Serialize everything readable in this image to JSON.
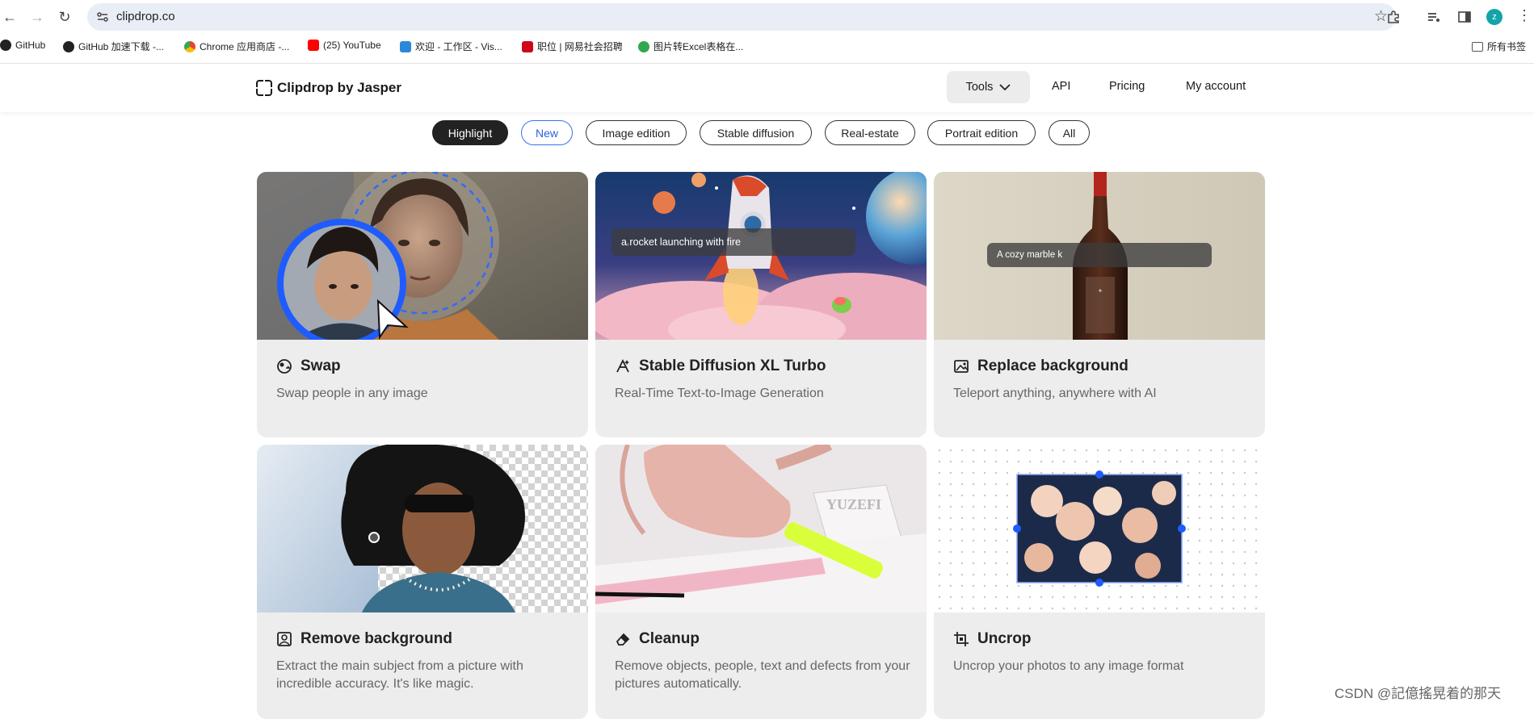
{
  "browser": {
    "url": "clipdrop.co",
    "avatar_letter": "z",
    "bookmarks": [
      {
        "label": "GitHub",
        "icon": "github-icon"
      },
      {
        "label": "GitHub 加速下载 -...",
        "icon": "github-icon"
      },
      {
        "label": "Chrome 应用商店 -...",
        "icon": "chrome-webstore-icon"
      },
      {
        "label": "(25) YouTube",
        "icon": "youtube-icon"
      },
      {
        "label": "欢迎 - 工作区 - Vis...",
        "icon": "vscode-icon"
      },
      {
        "label": "职位 | 网易社会招聘",
        "icon": "netease-icon"
      },
      {
        "label": "图片转Excel表格在...",
        "icon": "green-logo-icon"
      }
    ],
    "all_bookmarks_label": "所有书签"
  },
  "header": {
    "logo_text": "Clipdrop by Jasper",
    "nav": {
      "tools": "Tools",
      "api": "API",
      "pricing": "Pricing",
      "account": "My account"
    }
  },
  "filters": [
    "Highlight",
    "New",
    "Image edition",
    "Stable diffusion",
    "Real-estate",
    "Portrait edition",
    "All"
  ],
  "active_filter": "Highlight",
  "cards": [
    {
      "title": "Swap",
      "description": "Swap people in any image",
      "icon": "swap-icon"
    },
    {
      "title": "Stable Diffusion XL Turbo",
      "description": "Real-Time Text-to-Image Generation",
      "icon": "stable-diffusion-icon",
      "prompt": "a rocket launching with fire"
    },
    {
      "title": "Replace background",
      "description": "Teleport anything, anywhere with AI",
      "icon": "replace-background-icon",
      "prompt": "A cozy marble k"
    },
    {
      "title": "Remove background",
      "description": "Extract the main subject from a picture with incredible accuracy. It's like magic.",
      "icon": "remove-background-icon"
    },
    {
      "title": "Cleanup",
      "description": "Remove objects, people, text and defects from your pictures automatically.",
      "icon": "eraser-icon"
    },
    {
      "title": "Uncrop",
      "description": "Uncrop your photos to any image format",
      "icon": "uncrop-icon"
    }
  ],
  "watermark": "CSDN @記億搖晃着的那天",
  "colors": {
    "accent_blue": "#2b5fe0",
    "pill_active_bg": "#222222",
    "card_bg": "#ededed",
    "selection_blue": "#1f5cff"
  }
}
